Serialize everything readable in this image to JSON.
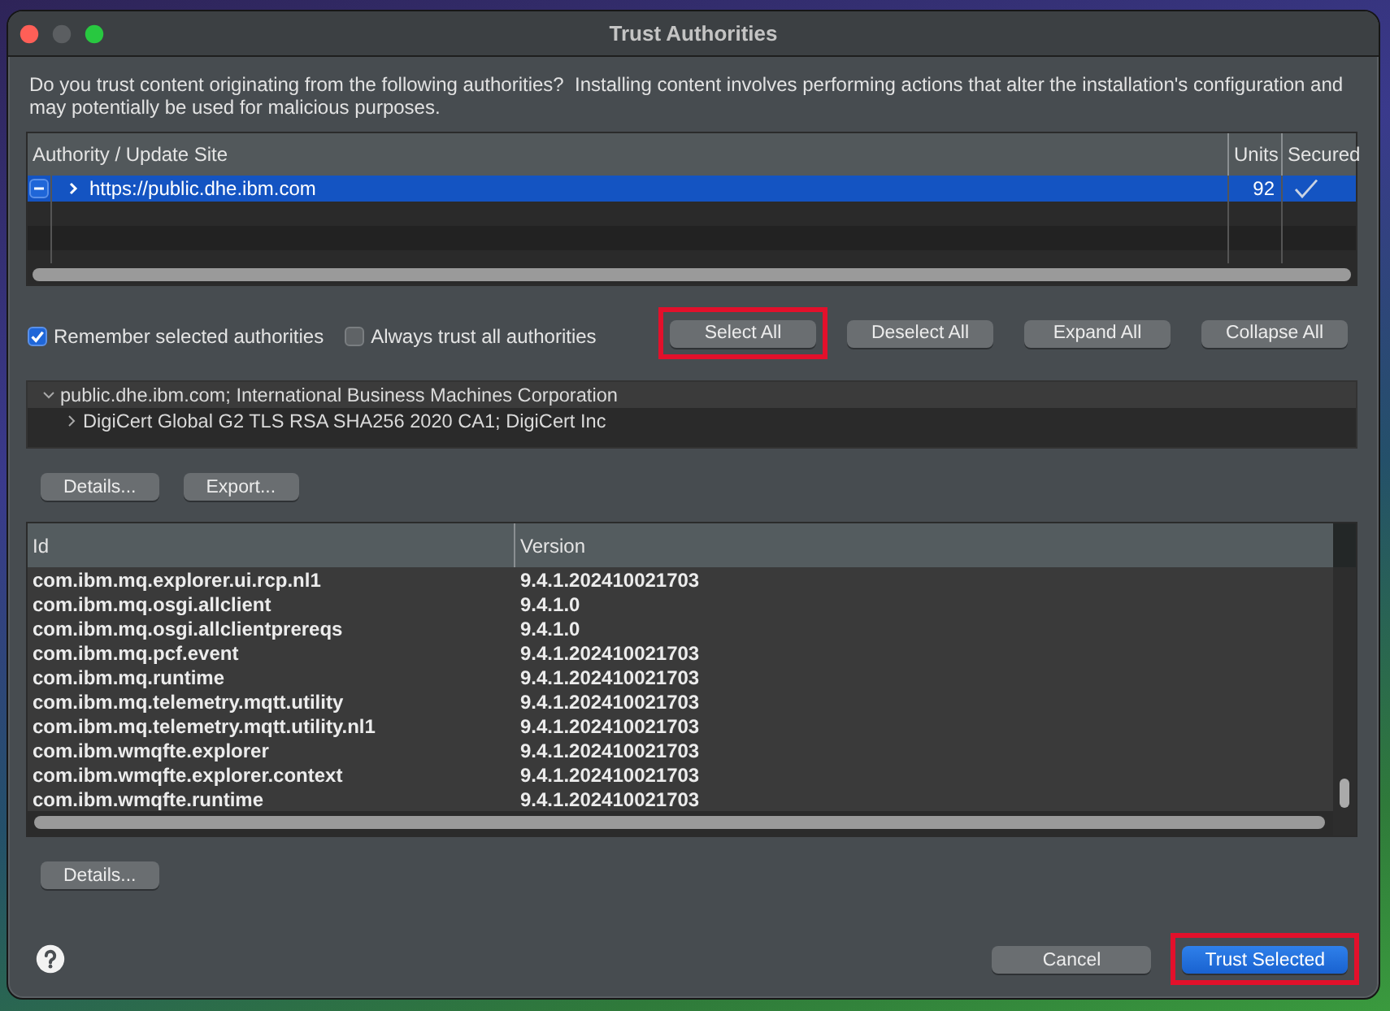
{
  "window": {
    "title": "Trust Authorities",
    "controls": [
      {
        "kind": "close",
        "disabled": false
      },
      {
        "kind": "minimize",
        "disabled": true
      },
      {
        "kind": "zoom",
        "disabled": false
      }
    ]
  },
  "message": "Do you trust content originating from the following authorities?  Installing content involves performing actions that alter the installation's configuration and may potentially be used for malicious purposes.",
  "authority_table": {
    "columns": [
      "Authority / Update Site",
      "Units",
      "Secured"
    ],
    "rows": [
      {
        "site": "https://public.dhe.ibm.com",
        "units": "92",
        "checked": false,
        "mixed": true,
        "expanded": false,
        "secured": true,
        "selected": true
      }
    ]
  },
  "options": [
    {
      "label": "Remember selected authorities",
      "checked": true
    },
    {
      "label": "Always trust all authorities",
      "checked": false
    }
  ],
  "selection_buttons": [
    {
      "label": "Select All",
      "highlighted": true
    },
    {
      "label": "Deselect All",
      "highlighted": false
    },
    {
      "label": "Expand All",
      "highlighted": false
    },
    {
      "label": "Collapse All",
      "highlighted": false
    }
  ],
  "certificate_tree": [
    {
      "label": "public.dhe.ibm.com; International Business Machines Corporation",
      "expanded": true,
      "selected": true,
      "children": [
        {
          "label": "DigiCert Global G2 TLS RSA SHA256 2020 CA1; DigiCert Inc",
          "expanded": false,
          "selected": false
        }
      ]
    }
  ],
  "certificate_buttons": [
    "Details...",
    "Export..."
  ],
  "units_table": {
    "columns": [
      "Id",
      "Version"
    ],
    "rows": [
      {
        "id": "com.ibm.mq.explorer.ui.rcp.nl1",
        "version": "9.4.1.202410021703"
      },
      {
        "id": "com.ibm.mq.osgi.allclient",
        "version": "9.4.1.0"
      },
      {
        "id": "com.ibm.mq.osgi.allclientprereqs",
        "version": "9.4.1.0"
      },
      {
        "id": "com.ibm.mq.pcf.event",
        "version": "9.4.1.202410021703"
      },
      {
        "id": "com.ibm.mq.runtime",
        "version": "9.4.1.202410021703"
      },
      {
        "id": "com.ibm.mq.telemetry.mqtt.utility",
        "version": "9.4.1.202410021703"
      },
      {
        "id": "com.ibm.mq.telemetry.mqtt.utility.nl1",
        "version": "9.4.1.202410021703"
      },
      {
        "id": "com.ibm.wmqfte.explorer",
        "version": "9.4.1.202410021703"
      },
      {
        "id": "com.ibm.wmqfte.explorer.context",
        "version": "9.4.1.202410021703"
      },
      {
        "id": "com.ibm.wmqfte.runtime",
        "version": "9.4.1.202410021703"
      }
    ]
  },
  "unit_buttons": [
    "Details..."
  ],
  "footer_buttons": [
    {
      "label": "Cancel",
      "primary": false,
      "highlighted": false
    },
    {
      "label": "Trust Selected",
      "primary": true,
      "highlighted": true
    }
  ]
}
